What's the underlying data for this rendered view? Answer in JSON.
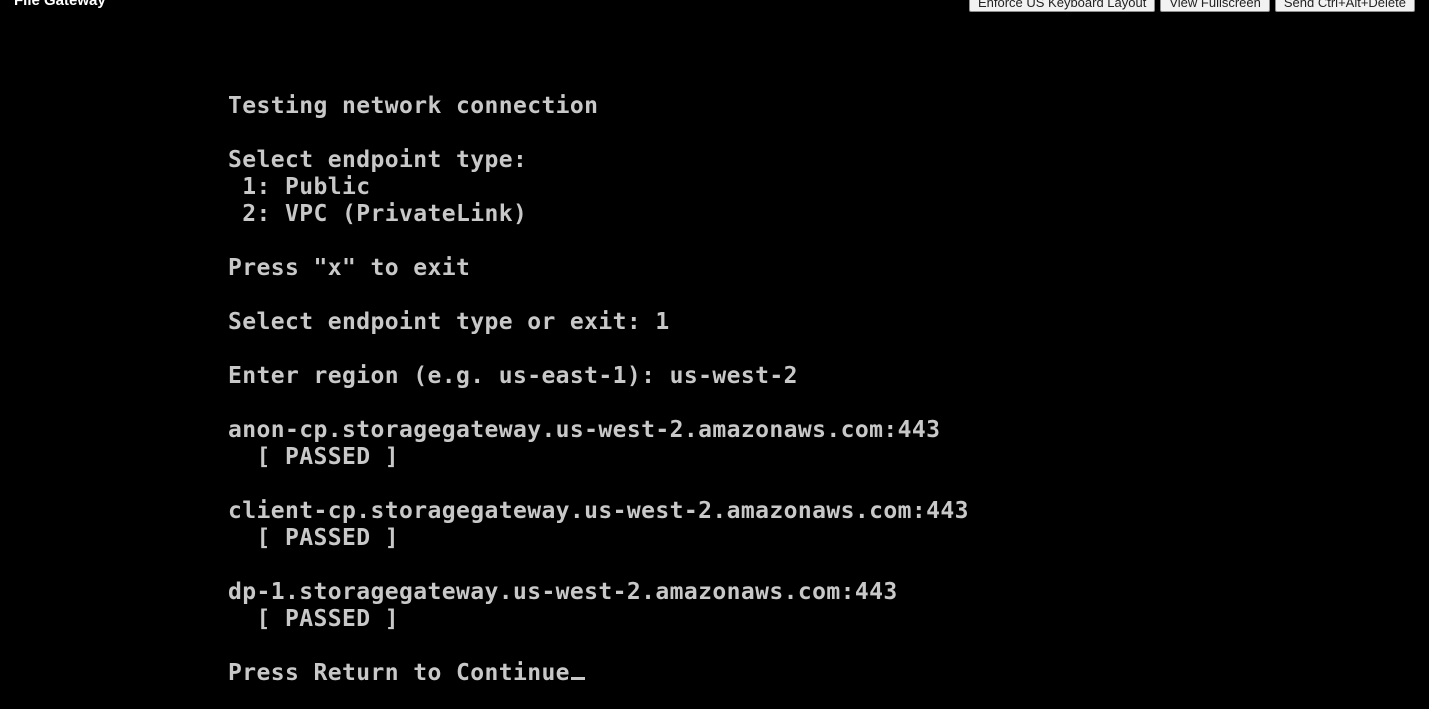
{
  "window": {
    "title": "File Gateway"
  },
  "toolbar": {
    "buttons": [
      {
        "label": "Enforce US Keyboard Layout"
      },
      {
        "label": "View Fullscreen"
      },
      {
        "label": "Send Ctrl+Alt+Delete"
      }
    ]
  },
  "console": {
    "lines": [
      "Testing network connection",
      "",
      "Select endpoint type:",
      " 1: Public",
      " 2: VPC (PrivateLink)",
      "",
      "Press \"x\" to exit",
      "",
      "Select endpoint type or exit: 1",
      "",
      "Enter region (e.g. us-east-1): us-west-2",
      "",
      "anon-cp.storagegateway.us-west-2.amazonaws.com:443",
      "  [ PASSED ]",
      "",
      "client-cp.storagegateway.us-west-2.amazonaws.com:443",
      "  [ PASSED ]",
      "",
      "dp-1.storagegateway.us-west-2.amazonaws.com:443",
      "  [ PASSED ]",
      "",
      "Press Return to Continue"
    ]
  },
  "colors": {
    "background": "#000000",
    "console_text": "#c8c8c8",
    "title_text": "#ffffff",
    "button_bg": "#f2f2f2"
  }
}
